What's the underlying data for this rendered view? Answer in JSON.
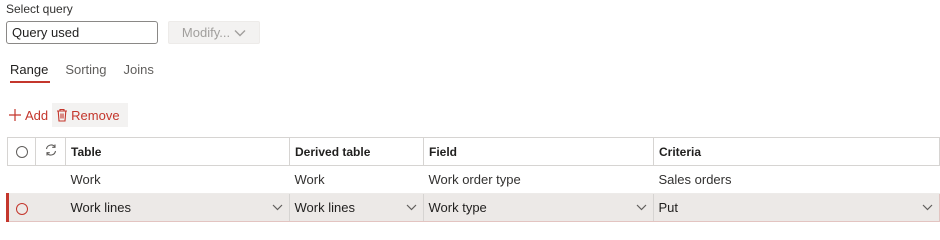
{
  "select_query": {
    "label": "Select query",
    "input_value": "Query used",
    "modify_label": "Modify..."
  },
  "tabs": [
    {
      "label": "Range",
      "active": true
    },
    {
      "label": "Sorting",
      "active": false
    },
    {
      "label": "Joins",
      "active": false
    }
  ],
  "actions": {
    "add_label": "Add",
    "remove_label": "Remove"
  },
  "grid": {
    "columns": [
      "Table",
      "Derived table",
      "Field",
      "Criteria"
    ],
    "rows": [
      {
        "table": "Work",
        "derived_table": "Work",
        "field": "Work order type",
        "criteria": "Sales orders"
      },
      {
        "table": "Work lines",
        "derived_table": "Work lines",
        "field": "Work type",
        "criteria": "Put"
      }
    ]
  },
  "colors": {
    "accent": "#c4362c",
    "disabled_text": "#a19f9d",
    "selected_row_bg": "#ece9e7"
  },
  "icons": {
    "add": "plus-icon",
    "remove": "trash-icon",
    "refresh": "refresh-icon",
    "select": "radio-icon",
    "dropdown": "chevron-down-icon"
  }
}
